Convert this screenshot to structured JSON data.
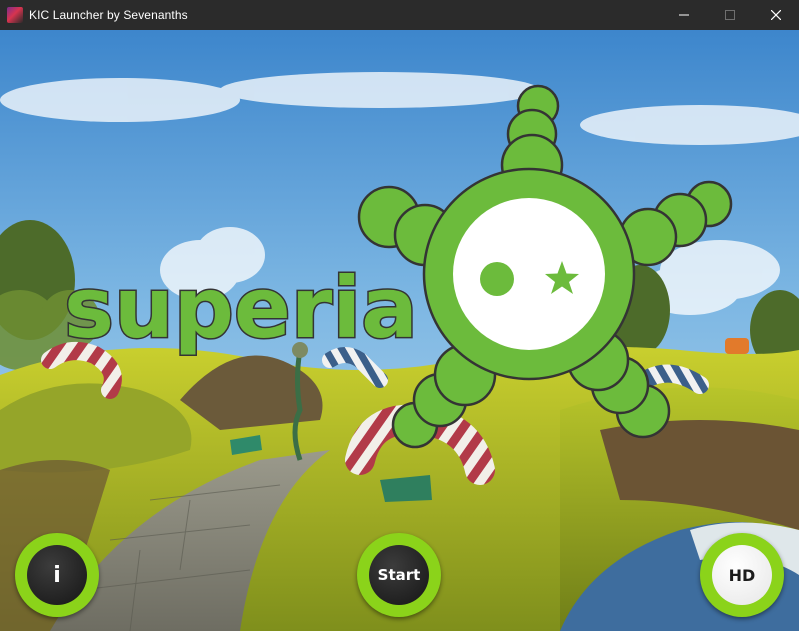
{
  "window": {
    "title": "KIC Launcher by Sevenanths",
    "app_icon": "kic-app-icon",
    "controls": [
      "minimize-icon",
      "maximize-icon",
      "close-icon"
    ]
  },
  "logo": {
    "text": "superia",
    "color": "#6cbb3c"
  },
  "buttons": {
    "info_label": "i",
    "start_label": "Start",
    "hd_label": "HD"
  },
  "colors": {
    "accent": "#8bd31a",
    "titlebar": "#2b2b2b",
    "logo_green": "#6cbb3c",
    "sky": "#6aa7d8"
  }
}
